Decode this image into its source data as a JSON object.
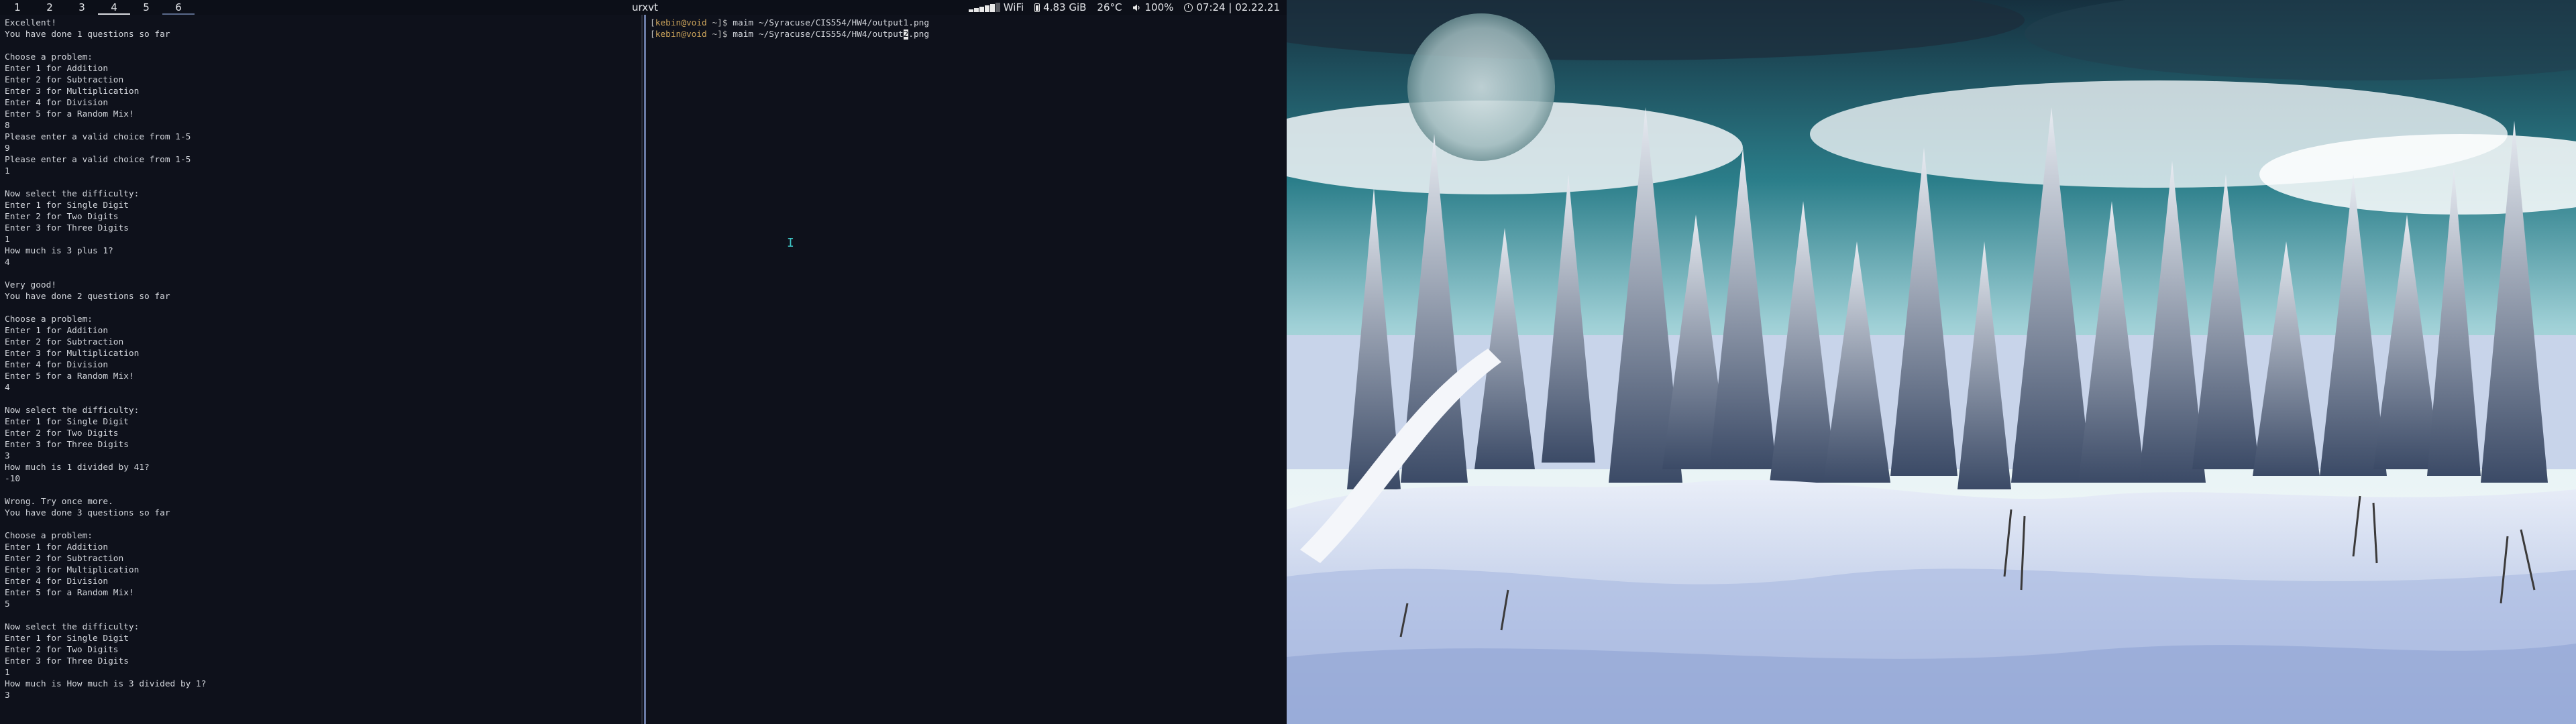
{
  "topbar": {
    "workspaces": [
      "1",
      "2",
      "3",
      "4",
      "5",
      "6"
    ],
    "active_workspace": "4",
    "window_title": "urxvt",
    "wifi_label": "WiFi",
    "memory": "4.83 GiB",
    "temperature": "26°C",
    "volume": "100%",
    "clock": "07:24 | 02.22.21",
    "wifi_signal_level": 0.8
  },
  "left_terminal": {
    "lines": [
      "Excellent!",
      "You have done 1 questions so far",
      "",
      "Choose a problem:",
      "Enter 1 for Addition",
      "Enter 2 for Subtraction",
      "Enter 3 for Multiplication",
      "Enter 4 for Division",
      "Enter 5 for a Random Mix!",
      "8",
      "Please enter a valid choice from 1-5",
      "9",
      "Please enter a valid choice from 1-5",
      "1",
      "",
      "Now select the difficulty:",
      "Enter 1 for Single Digit",
      "Enter 2 for Two Digits",
      "Enter 3 for Three Digits",
      "1",
      "How much is 3 plus 1?",
      "4",
      "",
      "Very good!",
      "You have done 2 questions so far",
      "",
      "Choose a problem:",
      "Enter 1 for Addition",
      "Enter 2 for Subtraction",
      "Enter 3 for Multiplication",
      "Enter 4 for Division",
      "Enter 5 for a Random Mix!",
      "4",
      "",
      "Now select the difficulty:",
      "Enter 1 for Single Digit",
      "Enter 2 for Two Digits",
      "Enter 3 for Three Digits",
      "3",
      "How much is 1 divided by 41?",
      "-10",
      "",
      "Wrong. Try once more.",
      "You have done 3 questions so far",
      "",
      "Choose a problem:",
      "Enter 1 for Addition",
      "Enter 2 for Subtraction",
      "Enter 3 for Multiplication",
      "Enter 4 for Division",
      "Enter 5 for a Random Mix!",
      "5",
      "",
      "Now select the difficulty:",
      "Enter 1 for Single Digit",
      "Enter 2 for Two Digits",
      "Enter 3 for Three Digits",
      "1",
      "How much is How much is 3 divided by 1?",
      "3"
    ]
  },
  "right_terminal": {
    "prompt_user": "kebin@void",
    "prompt_dir": "~",
    "commands": [
      {
        "before_cursor": "maim ~/Syracuse/CIS554/HW4/output1.png",
        "cursor_char": "",
        "after_cursor": ""
      },
      {
        "before_cursor": "maim ~/Syracuse/CIS554/HW4/output",
        "cursor_char": "2",
        "after_cursor": ".png"
      }
    ]
  },
  "colors": {
    "terminal_bg": "#0e111b",
    "terminal_fg": "#d3d6dc",
    "prompt_user": "#c8a15a",
    "bar_bg": "#0c0f18",
    "focus_border": "#6a7ba6"
  }
}
